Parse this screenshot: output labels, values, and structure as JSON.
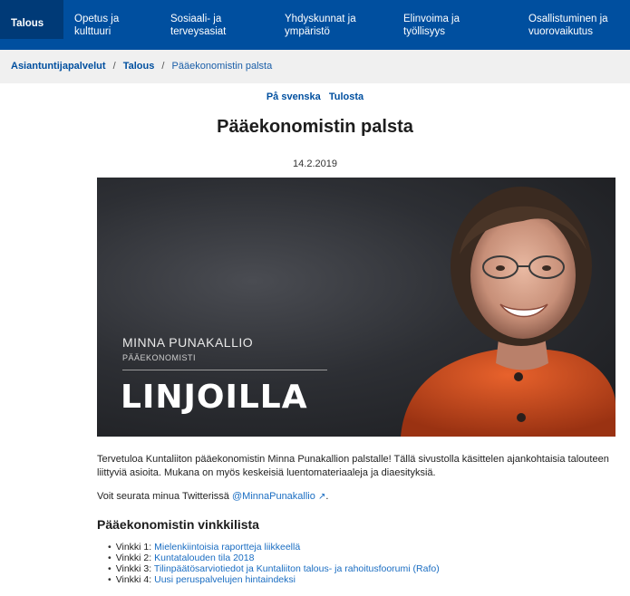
{
  "nav": {
    "tabs": [
      {
        "label": "Talous"
      },
      {
        "label": "Opetus ja\nkulttuuri"
      },
      {
        "label": "Sosiaali- ja\nterveysasiat"
      },
      {
        "label": "Yhdyskunnat ja\nympäristö"
      },
      {
        "label": "Elinvoima ja\ntyöllisyys"
      },
      {
        "label": "Osallistuminen ja\nvuorovaikutus"
      }
    ]
  },
  "breadcrumb": {
    "root": "Asiantuntijapalvelut",
    "section": "Talous",
    "current": "Pääekonomistin palsta",
    "separator": "/"
  },
  "lang": {
    "swedish": "På svenska",
    "print": "Tulosta"
  },
  "page": {
    "title": "Pääekonomistin palsta",
    "date": "14.2.2019"
  },
  "hero": {
    "name": "MINNA PUNAKALLIO",
    "role": "PÄÄEKONOMISTI",
    "headline": "LINJOILLA"
  },
  "intro": "Tervetuloa Kuntaliiton pääekonomistin Minna Punakallion palstalle! Tällä sivustolla käsittelen ajankohtaisia talouteen liittyviä asioita. Mukana on myös keskeisiä luentomateriaaleja ja diaesityksiä.",
  "twitter": {
    "text": "Voit seurata minua Twitterissä ",
    "handle": "@MinnaPunakallio",
    "suffix": "."
  },
  "tips": {
    "heading": "Pääekonomistin vinkkilista",
    "items": [
      {
        "label": "Vinkki 1: ",
        "link": "Mielenkiintoisia raportteja liikkeellä"
      },
      {
        "label": "Vinkki 2: ",
        "link": "Kuntatalouden tila 2018"
      },
      {
        "label": "Vinkki 3: ",
        "link": "Tilinpäätösarviotiedot ja Kuntaliiton talous- ja rahoitusfoorumi (Rafo)"
      },
      {
        "label": "Vinkki 4: ",
        "link": "Uusi peruspalvelujen hintaindeksi"
      }
    ]
  }
}
